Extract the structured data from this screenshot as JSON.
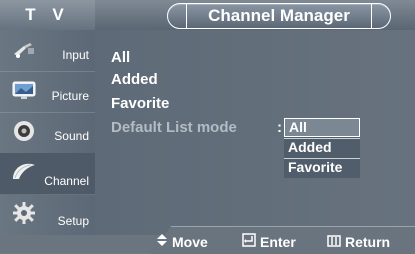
{
  "header": {
    "tv_label": "T V",
    "title": "Channel Manager"
  },
  "sidebar": {
    "items": [
      {
        "label": "Input",
        "icon": "input-plug-icon"
      },
      {
        "label": "Picture",
        "icon": "picture-monitor-icon"
      },
      {
        "label": "Sound",
        "icon": "speaker-icon"
      },
      {
        "label": "Channel",
        "icon": "satellite-dish-icon",
        "active": true
      },
      {
        "label": "Setup",
        "icon": "gear-icon"
      }
    ]
  },
  "main": {
    "items": [
      "All",
      "Added",
      "Favorite"
    ],
    "setting_label": "Default List mode",
    "colon": ":"
  },
  "dropdown": {
    "options": [
      "All",
      "Added",
      "Favorite"
    ],
    "selected_index": 0
  },
  "footer": {
    "move": "Move",
    "enter": "Enter",
    "return": "Return",
    "move_icon": "up-down-arrow-icon",
    "enter_icon": "enter-icon",
    "return_icon": "menu-return-icon"
  },
  "colors": {
    "background": "#5f6c79",
    "highlight": "#7b8792",
    "text": "#ffffff",
    "dim_text": "#b3bcc5"
  }
}
